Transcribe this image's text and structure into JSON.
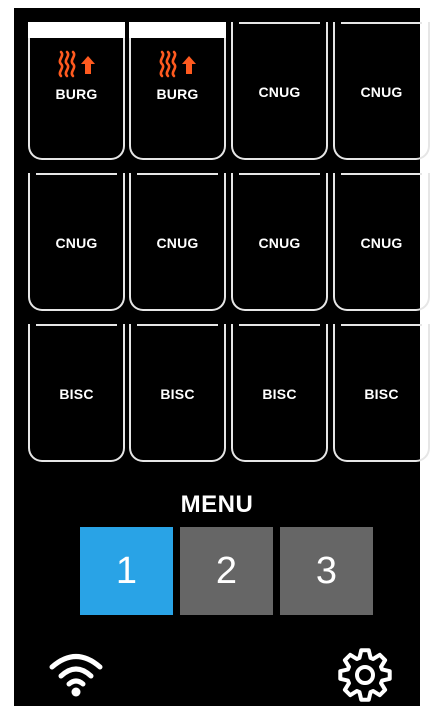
{
  "colors": {
    "background": "#000000",
    "slot_border": "#e6e6e6",
    "heat_icon": "#ff5a1f",
    "menu_active": "#29a3e6",
    "menu_inactive": "#666666"
  },
  "slots": [
    {
      "label": "BURG",
      "status": "heating-up",
      "progress": 1.0
    },
    {
      "label": "BURG",
      "status": "heating-up",
      "progress": 1.0
    },
    {
      "label": "CNUG"
    },
    {
      "label": "CNUG"
    },
    {
      "label": "CNUG"
    },
    {
      "label": "CNUG"
    },
    {
      "label": "CNUG"
    },
    {
      "label": "CNUG"
    },
    {
      "label": "BISC"
    },
    {
      "label": "BISC"
    },
    {
      "label": "BISC"
    },
    {
      "label": "BISC"
    }
  ],
  "menu": {
    "title": "MENU",
    "buttons": [
      {
        "label": "1",
        "active": true
      },
      {
        "label": "2",
        "active": false
      },
      {
        "label": "3",
        "active": false
      }
    ]
  },
  "footer": {
    "wifi_icon": "wifi-icon",
    "settings_icon": "gear-icon"
  }
}
